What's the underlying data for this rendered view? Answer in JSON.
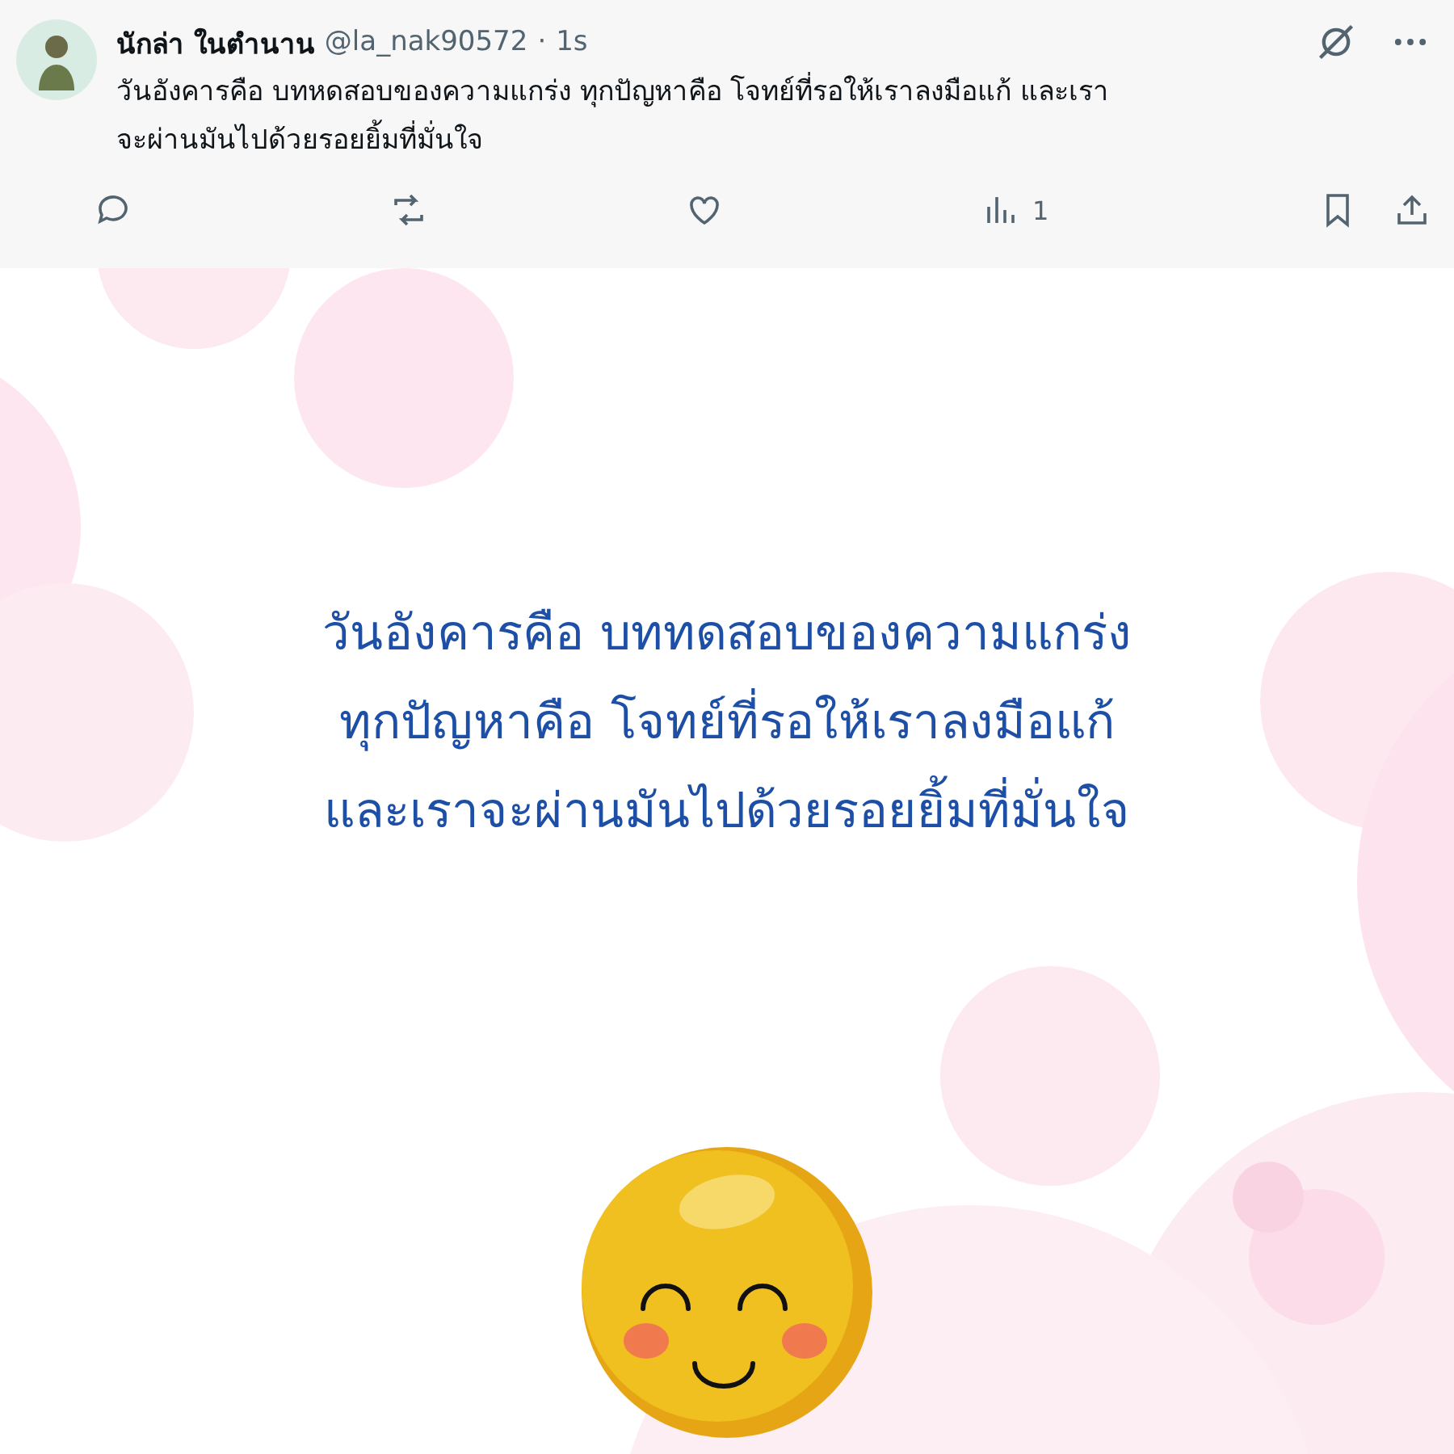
{
  "post": {
    "author": "นักล่า ในตำนาน",
    "handle": "@la_nak90572",
    "separator": "·",
    "time": "1s",
    "text": "วันอังคารคือ บทหดสอบของความแกร่ง ทุกปัญหาคือ โจทย์ที่รอให้เราลงมือแก้ และเรา จะผ่านมันไปด้วยรอยยิ้มที่มั่นใจ",
    "actions": [
      {
        "kind": "reply"
      },
      {
        "kind": "repost"
      },
      {
        "kind": "like"
      },
      {
        "kind": "views",
        "count": "1"
      },
      {
        "kind": "bookmark"
      },
      {
        "kind": "share"
      }
    ]
  },
  "image_card": {
    "lines": [
      "วันอังคารคือ บททดสอบของความแกร่ง",
      "ทุกปัญหาคือ โจทย์ที่รอให้เราลงมือแก้",
      "และเราจะผ่านมันไปด้วยรอยยิ้มที่มั่นใจ"
    ]
  }
}
